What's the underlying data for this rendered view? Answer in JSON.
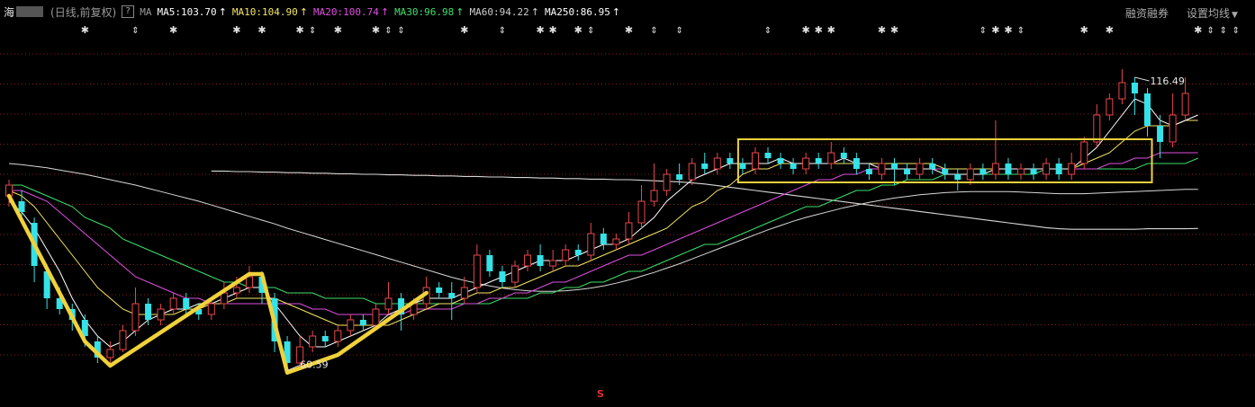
{
  "header": {
    "stock_name": "海",
    "period": "(日线,前复权)",
    "help": "?",
    "ma_label": "MA",
    "ma_items": [
      {
        "label": "MA5:103.70",
        "color": "#ffffff",
        "arrow": "↑"
      },
      {
        "label": "MA10:104.90",
        "color": "#f5e663",
        "arrow": "↑"
      },
      {
        "label": "MA20:100.74",
        "color": "#e04fe0",
        "arrow": "↑"
      },
      {
        "label": "MA30:96.98",
        "color": "#3ee06a",
        "arrow": "↑"
      },
      {
        "label": "MA60:94.22",
        "color": "#cfcfcf",
        "arrow": "↑"
      },
      {
        "label": "MA250:86.95",
        "color": "#ffffff",
        "arrow": "↑"
      }
    ],
    "margin_trading": "融资融券",
    "settings": "设置均线",
    "dropdown_icon": "▼"
  },
  "colors": {
    "up": "#e8484a",
    "down": "#35e2e7",
    "highlight": "#f0d23a",
    "grid": "#8a1e1e",
    "ma5": "#ffffff",
    "ma10": "#f5e663",
    "ma20": "#e04fe0",
    "ma30": "#3ee06a",
    "ma60": "#d8d8d8"
  },
  "markers": {
    "star_glyph": "✱",
    "bar_glyph": "⇕",
    "bottom_mark": "S"
  },
  "chart_data": {
    "type": "candlestick",
    "title": "",
    "annotations": [
      {
        "text": "116.49",
        "kind": "period-high",
        "index": 89
      },
      {
        "text": "60.59",
        "kind": "period-low",
        "index": 22
      }
    ],
    "candles": [
      {
        "o": 93,
        "c": 95,
        "h": 96,
        "l": 91
      },
      {
        "o": 92,
        "c": 90,
        "h": 94,
        "l": 88
      },
      {
        "o": 88,
        "c": 80,
        "h": 89,
        "l": 77
      },
      {
        "o": 79,
        "c": 74,
        "h": 80,
        "l": 72
      },
      {
        "o": 74,
        "c": 72,
        "h": 76,
        "l": 71
      },
      {
        "o": 72,
        "c": 70,
        "h": 73,
        "l": 68
      },
      {
        "o": 70,
        "c": 67,
        "h": 71,
        "l": 65
      },
      {
        "o": 66,
        "c": 63,
        "h": 67,
        "l": 62
      },
      {
        "o": 63,
        "c": 64.5,
        "h": 66,
        "l": 62
      },
      {
        "o": 64.5,
        "c": 68,
        "h": 69,
        "l": 64
      },
      {
        "o": 68,
        "c": 73,
        "h": 76,
        "l": 67
      },
      {
        "o": 73,
        "c": 70,
        "h": 74,
        "l": 69
      },
      {
        "o": 70,
        "c": 72,
        "h": 73,
        "l": 69
      },
      {
        "o": 72,
        "c": 74,
        "h": 75,
        "l": 71
      },
      {
        "o": 74,
        "c": 72,
        "h": 75,
        "l": 71
      },
      {
        "o": 72,
        "c": 71,
        "h": 73,
        "l": 70
      },
      {
        "o": 71,
        "c": 73,
        "h": 74,
        "l": 70
      },
      {
        "o": 73,
        "c": 75,
        "h": 77,
        "l": 72
      },
      {
        "o": 75,
        "c": 76,
        "h": 78,
        "l": 74
      },
      {
        "o": 76,
        "c": 78,
        "h": 80,
        "l": 75
      },
      {
        "o": 78,
        "c": 75,
        "h": 79,
        "l": 73
      },
      {
        "o": 74,
        "c": 66,
        "h": 75,
        "l": 64
      },
      {
        "o": 66,
        "c": 62,
        "h": 67,
        "l": 60.59
      },
      {
        "o": 62,
        "c": 65,
        "h": 67,
        "l": 61
      },
      {
        "o": 65,
        "c": 67,
        "h": 68,
        "l": 64
      },
      {
        "o": 67,
        "c": 66,
        "h": 68,
        "l": 65
      },
      {
        "o": 66,
        "c": 68,
        "h": 69,
        "l": 65
      },
      {
        "o": 68,
        "c": 70,
        "h": 71,
        "l": 67
      },
      {
        "o": 70,
        "c": 69,
        "h": 71,
        "l": 68
      },
      {
        "o": 69,
        "c": 72,
        "h": 73,
        "l": 68
      },
      {
        "o": 72,
        "c": 74,
        "h": 77,
        "l": 71
      },
      {
        "o": 74,
        "c": 71,
        "h": 75,
        "l": 68
      },
      {
        "o": 71,
        "c": 73,
        "h": 74,
        "l": 70
      },
      {
        "o": 73,
        "c": 76,
        "h": 78,
        "l": 72
      },
      {
        "o": 76,
        "c": 75,
        "h": 77,
        "l": 74
      },
      {
        "o": 75,
        "c": 74,
        "h": 77,
        "l": 70
      },
      {
        "o": 74,
        "c": 76,
        "h": 78,
        "l": 73
      },
      {
        "o": 76,
        "c": 82,
        "h": 84,
        "l": 75
      },
      {
        "o": 82,
        "c": 79,
        "h": 83,
        "l": 78
      },
      {
        "o": 79,
        "c": 77,
        "h": 80,
        "l": 76
      },
      {
        "o": 77,
        "c": 80,
        "h": 81,
        "l": 76
      },
      {
        "o": 80,
        "c": 82,
        "h": 83,
        "l": 79
      },
      {
        "o": 82,
        "c": 80,
        "h": 84,
        "l": 79
      },
      {
        "o": 80,
        "c": 81,
        "h": 83,
        "l": 79
      },
      {
        "o": 81,
        "c": 83,
        "h": 84,
        "l": 80
      },
      {
        "o": 83,
        "c": 82,
        "h": 84,
        "l": 81
      },
      {
        "o": 82,
        "c": 86,
        "h": 88,
        "l": 81
      },
      {
        "o": 86,
        "c": 84,
        "h": 87,
        "l": 83
      },
      {
        "o": 84,
        "c": 85,
        "h": 86,
        "l": 83
      },
      {
        "o": 85,
        "c": 88,
        "h": 90,
        "l": 84
      },
      {
        "o": 88,
        "c": 92,
        "h": 95,
        "l": 87
      },
      {
        "o": 92,
        "c": 94,
        "h": 99,
        "l": 91
      },
      {
        "o": 94,
        "c": 97,
        "h": 98,
        "l": 93
      },
      {
        "o": 97,
        "c": 96,
        "h": 99,
        "l": 95
      },
      {
        "o": 96,
        "c": 99,
        "h": 100,
        "l": 95
      },
      {
        "o": 99,
        "c": 98,
        "h": 101,
        "l": 97
      },
      {
        "o": 98,
        "c": 100,
        "h": 101,
        "l": 97
      },
      {
        "o": 100,
        "c": 99,
        "h": 101,
        "l": 98
      },
      {
        "o": 99,
        "c": 98,
        "h": 100,
        "l": 97
      },
      {
        "o": 98,
        "c": 101,
        "h": 102,
        "l": 97
      },
      {
        "o": 101,
        "c": 100,
        "h": 102,
        "l": 99
      },
      {
        "o": 100,
        "c": 99,
        "h": 101,
        "l": 98
      },
      {
        "o": 99,
        "c": 98,
        "h": 100,
        "l": 97
      },
      {
        "o": 98,
        "c": 100,
        "h": 101,
        "l": 97
      },
      {
        "o": 100,
        "c": 99,
        "h": 101,
        "l": 98
      },
      {
        "o": 99,
        "c": 101,
        "h": 103,
        "l": 98
      },
      {
        "o": 101,
        "c": 100,
        "h": 102,
        "l": 99
      },
      {
        "o": 100,
        "c": 98,
        "h": 101,
        "l": 97
      },
      {
        "o": 98,
        "c": 97,
        "h": 99,
        "l": 96
      },
      {
        "o": 97,
        "c": 99,
        "h": 100,
        "l": 96
      },
      {
        "o": 99,
        "c": 98,
        "h": 100,
        "l": 95
      },
      {
        "o": 98,
        "c": 97,
        "h": 99,
        "l": 96
      },
      {
        "o": 97,
        "c": 99,
        "h": 100,
        "l": 96
      },
      {
        "o": 99,
        "c": 98,
        "h": 100,
        "l": 97
      },
      {
        "o": 98,
        "c": 97,
        "h": 99,
        "l": 96
      },
      {
        "o": 97,
        "c": 96,
        "h": 98,
        "l": 94
      },
      {
        "o": 96,
        "c": 98,
        "h": 99,
        "l": 95
      },
      {
        "o": 98,
        "c": 97,
        "h": 99,
        "l": 96
      },
      {
        "o": 97,
        "c": 99,
        "h": 107,
        "l": 96
      },
      {
        "o": 99,
        "c": 97,
        "h": 100,
        "l": 96
      },
      {
        "o": 97,
        "c": 98,
        "h": 99,
        "l": 96
      },
      {
        "o": 98,
        "c": 97,
        "h": 99,
        "l": 96
      },
      {
        "o": 97,
        "c": 99,
        "h": 100,
        "l": 96
      },
      {
        "o": 99,
        "c": 97,
        "h": 100,
        "l": 96
      },
      {
        "o": 97,
        "c": 99,
        "h": 101,
        "l": 96
      },
      {
        "o": 99,
        "c": 103,
        "h": 104,
        "l": 98
      },
      {
        "o": 103,
        "c": 108,
        "h": 110,
        "l": 102
      },
      {
        "o": 108,
        "c": 111,
        "h": 112,
        "l": 107
      },
      {
        "o": 111,
        "c": 114,
        "h": 116.49,
        "l": 110
      },
      {
        "o": 114,
        "c": 112,
        "h": 115,
        "l": 108
      },
      {
        "o": 112,
        "c": 106,
        "h": 113,
        "l": 104
      },
      {
        "o": 106,
        "c": 103,
        "h": 108,
        "l": 100
      },
      {
        "o": 103,
        "c": 108,
        "h": 112,
        "l": 102
      },
      {
        "o": 108,
        "c": 112,
        "h": 115,
        "l": 107
      }
    ],
    "ma5": [
      92,
      90,
      87,
      83,
      79,
      74,
      70,
      67,
      65,
      66,
      68,
      70,
      71,
      72,
      72,
      73,
      73,
      74,
      75,
      76,
      76,
      73,
      70,
      67,
      65,
      65,
      66,
      67,
      68,
      69,
      71,
      72,
      73,
      74,
      74,
      74,
      75,
      76,
      77,
      78,
      79,
      80,
      81,
      81,
      81,
      82,
      83,
      84,
      84,
      85,
      87,
      89,
      92,
      94,
      96,
      97,
      98,
      99,
      99,
      99,
      99,
      100,
      99,
      99,
      99,
      99,
      100,
      99,
      99,
      98,
      98,
      98,
      98,
      98,
      97,
      97,
      97,
      97,
      98,
      98,
      98,
      98,
      98,
      98,
      98,
      100,
      102,
      105,
      108,
      111,
      110,
      107,
      106,
      107,
      108
    ],
    "ma10": [
      94,
      93,
      91,
      88,
      85,
      82,
      79,
      76,
      74,
      72,
      71,
      71,
      71,
      71,
      72,
      72,
      73,
      73,
      74,
      74,
      74,
      74,
      73,
      72,
      71,
      70,
      69,
      69,
      69,
      69,
      69,
      70,
      71,
      72,
      73,
      73,
      74,
      75,
      75,
      76,
      76,
      77,
      78,
      79,
      80,
      80,
      81,
      82,
      83,
      84,
      85,
      86,
      87,
      89,
      91,
      92,
      94,
      95,
      97,
      98,
      98,
      99,
      99,
      99,
      99,
      99,
      99,
      99,
      99,
      99,
      99,
      99,
      99,
      99,
      98,
      98,
      98,
      98,
      98,
      98,
      98,
      98,
      98,
      98,
      98,
      99,
      100,
      101,
      103,
      105,
      106,
      106,
      106,
      107,
      107
    ],
    "ma20": [
      94,
      94,
      93,
      92,
      90,
      88,
      86,
      84,
      82,
      80,
      78,
      77,
      76,
      75,
      74,
      74,
      73,
      73,
      73,
      73,
      73,
      73,
      73,
      73,
      72,
      72,
      71,
      71,
      71,
      71,
      71,
      71,
      72,
      72,
      72,
      72,
      73,
      73,
      74,
      74,
      75,
      75,
      76,
      77,
      77,
      78,
      79,
      80,
      81,
      82,
      82,
      83,
      84,
      85,
      86,
      87,
      88,
      89,
      90,
      91,
      92,
      93,
      94,
      95,
      96,
      96,
      97,
      97,
      98,
      98,
      98,
      98,
      98,
      98,
      98,
      98,
      98,
      98,
      98,
      98,
      98,
      98,
      98,
      98,
      98,
      98,
      98,
      99,
      99,
      100,
      100,
      101,
      101,
      101,
      101
    ],
    "ma30": [
      95,
      95,
      94,
      93,
      92,
      91,
      89,
      88,
      87,
      85,
      84,
      83,
      82,
      81,
      80,
      79,
      78,
      77,
      77,
      76,
      76,
      76,
      75,
      75,
      75,
      74,
      74,
      74,
      74,
      73,
      73,
      73,
      73,
      73,
      73,
      73,
      73,
      73,
      73,
      74,
      74,
      74,
      75,
      75,
      76,
      76,
      77,
      77,
      78,
      79,
      79,
      80,
      81,
      82,
      83,
      84,
      84,
      85,
      86,
      87,
      88,
      89,
      90,
      91,
      91,
      92,
      93,
      94,
      94,
      95,
      95,
      96,
      96,
      96,
      97,
      97,
      97,
      97,
      97,
      97,
      97,
      97,
      98,
      98,
      98,
      98,
      98,
      98,
      98,
      98,
      99,
      99,
      99,
      99,
      100
    ],
    "ma60": [
      99,
      98.8,
      98.5,
      98.2,
      97.8,
      97.4,
      97,
      96.5,
      96,
      95.5,
      95,
      94.4,
      93.8,
      93.2,
      92.6,
      92,
      91.3,
      90.6,
      89.9,
      89.2,
      88.5,
      87.8,
      87,
      86.3,
      85.6,
      84.9,
      84.2,
      83.5,
      82.8,
      82.1,
      81.4,
      80.7,
      80,
      79.3,
      78.6,
      77.9,
      77.3,
      76.8,
      76.3,
      75.9,
      75.6,
      75.4,
      75.3,
      75.3,
      75.4,
      75.6,
      75.9,
      76.3,
      76.8,
      77.4,
      78.1,
      78.8,
      79.6,
      80.4,
      81.3,
      82.2,
      83.1,
      84,
      84.9,
      85.8,
      86.7,
      87.5,
      88.3,
      89,
      89.6,
      90.2,
      90.8,
      91.3,
      91.8,
      92.2,
      92.6,
      92.9,
      93.2,
      93.4,
      93.6,
      93.7,
      93.8,
      93.8,
      93.8,
      93.8,
      93.7,
      93.6,
      93.5,
      93.4,
      93.4,
      93.4,
      93.5,
      93.6,
      93.7,
      93.8,
      93.9,
      94,
      94.1,
      94.2,
      94.2
    ],
    "ma250": {
      "start_index": 16,
      "values": [
        97.6,
        97.6,
        97.5,
        97.5,
        97.4,
        97.4,
        97.3,
        97.3,
        97.2,
        97.2,
        97.1,
        97.1,
        97,
        97,
        96.9,
        96.9,
        96.8,
        96.8,
        96.7,
        96.7,
        96.6,
        96.6,
        96.5,
        96.5,
        96.4,
        96.4,
        96.3,
        96.3,
        96.2,
        96.2,
        96.1,
        96.1,
        96,
        96,
        95.9,
        95.8,
        95.7,
        95.6,
        95.4,
        95.2,
        94.9,
        94.6,
        94.3,
        94,
        93.7,
        93.4,
        93.1,
        92.8,
        92.5,
        92.2,
        91.9,
        91.6,
        91.3,
        91,
        90.7,
        90.4,
        90.1,
        89.8,
        89.5,
        89.2,
        88.9,
        88.6,
        88.3,
        88,
        87.7,
        87.4,
        87.1,
        86.9,
        86.8,
        86.8,
        86.8,
        86.8,
        86.8,
        86.8,
        86.9,
        86.9,
        86.9,
        86.9,
        86.95
      ]
    },
    "ylim": [
      58,
      122
    ],
    "grid": true,
    "overlays": {
      "zigzag": [
        [
          0,
          93
        ],
        [
          6,
          66
        ],
        [
          8,
          61.5
        ],
        [
          19,
          78.5
        ],
        [
          20,
          78.5
        ],
        [
          22,
          60.2
        ],
        [
          26,
          63.5
        ],
        [
          33,
          75
        ]
      ],
      "consolidation_box": {
        "x_from": 58,
        "x_to": 90,
        "y_low": 95.5,
        "y_high": 103.5
      }
    },
    "top_markers": [
      {
        "i": 6,
        "t": "star"
      },
      {
        "i": 10,
        "t": "bar"
      },
      {
        "i": 13,
        "t": "star"
      },
      {
        "i": 18,
        "t": "star"
      },
      {
        "i": 20,
        "t": "star"
      },
      {
        "i": 23,
        "t": "star"
      },
      {
        "i": 24,
        "t": "bar"
      },
      {
        "i": 26,
        "t": "star"
      },
      {
        "i": 29,
        "t": "star"
      },
      {
        "i": 30,
        "t": "bar"
      },
      {
        "i": 31,
        "t": "bar"
      },
      {
        "i": 36,
        "t": "star"
      },
      {
        "i": 39,
        "t": "bar"
      },
      {
        "i": 42,
        "t": "star"
      },
      {
        "i": 43,
        "t": "star"
      },
      {
        "i": 45,
        "t": "star"
      },
      {
        "i": 46,
        "t": "bar"
      },
      {
        "i": 49,
        "t": "star"
      },
      {
        "i": 51,
        "t": "bar"
      },
      {
        "i": 53,
        "t": "bar"
      },
      {
        "i": 60,
        "t": "bar"
      },
      {
        "i": 63,
        "t": "star"
      },
      {
        "i": 64,
        "t": "star"
      },
      {
        "i": 65,
        "t": "star"
      },
      {
        "i": 69,
        "t": "star"
      },
      {
        "i": 70,
        "t": "star"
      },
      {
        "i": 77,
        "t": "bar"
      },
      {
        "i": 78,
        "t": "star"
      },
      {
        "i": 79,
        "t": "star"
      },
      {
        "i": 80,
        "t": "bar"
      },
      {
        "i": 85,
        "t": "star"
      },
      {
        "i": 87,
        "t": "star"
      },
      {
        "i": 94,
        "t": "star"
      },
      {
        "i": 95,
        "t": "bar"
      },
      {
        "i": 96,
        "t": "bar"
      },
      {
        "i": 97,
        "t": "bar"
      },
      {
        "i": 99,
        "t": "star"
      },
      {
        "i": 100,
        "t": "bar"
      },
      {
        "i": 101,
        "t": "star"
      },
      {
        "i": 103,
        "t": "star"
      },
      {
        "i": 104,
        "t": "bar"
      }
    ]
  }
}
